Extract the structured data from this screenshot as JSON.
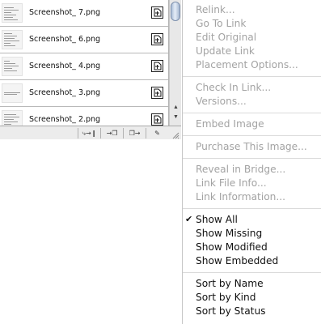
{
  "links_panel": {
    "rows": [
      {
        "name": "Screenshot_ 7.png"
      },
      {
        "name": "Screenshot_ 6.png"
      },
      {
        "name": "Screenshot_ 4.png"
      },
      {
        "name": "Screenshot_ 3.png"
      },
      {
        "name": "Screenshot_ 2.png"
      }
    ],
    "row_status_icon": "page-icon",
    "toolbar": {
      "relink": "⤷→❙",
      "goto": "→❐",
      "update": "❐→",
      "edit": "✎"
    },
    "scroll_up_glyph": "▲",
    "scroll_down_glyph": "▼"
  },
  "menu": {
    "groups": [
      [
        {
          "label": "Relink...",
          "enabled": false
        },
        {
          "label": "Go To Link",
          "enabled": false
        },
        {
          "label": "Edit Original",
          "enabled": false
        },
        {
          "label": "Update Link",
          "enabled": false
        },
        {
          "label": "Placement Options...",
          "enabled": false
        }
      ],
      [
        {
          "label": "Check In Link...",
          "enabled": false
        },
        {
          "label": "Versions...",
          "enabled": false
        }
      ],
      [
        {
          "label": "Embed Image",
          "enabled": false
        }
      ],
      [
        {
          "label": "Purchase This Image...",
          "enabled": false
        }
      ],
      [
        {
          "label": "Reveal in Bridge...",
          "enabled": false
        },
        {
          "label": "Link File Info...",
          "enabled": false
        },
        {
          "label": "Link Information...",
          "enabled": false
        }
      ],
      [
        {
          "label": "Show All",
          "enabled": true,
          "checked": true
        },
        {
          "label": "Show Missing",
          "enabled": true
        },
        {
          "label": "Show Modified",
          "enabled": true
        },
        {
          "label": "Show Embedded",
          "enabled": true
        }
      ],
      [
        {
          "label": "Sort by Name",
          "enabled": true
        },
        {
          "label": "Sort by Kind",
          "enabled": true
        },
        {
          "label": "Sort by Status",
          "enabled": true
        }
      ]
    ],
    "check_glyph": "✔"
  }
}
